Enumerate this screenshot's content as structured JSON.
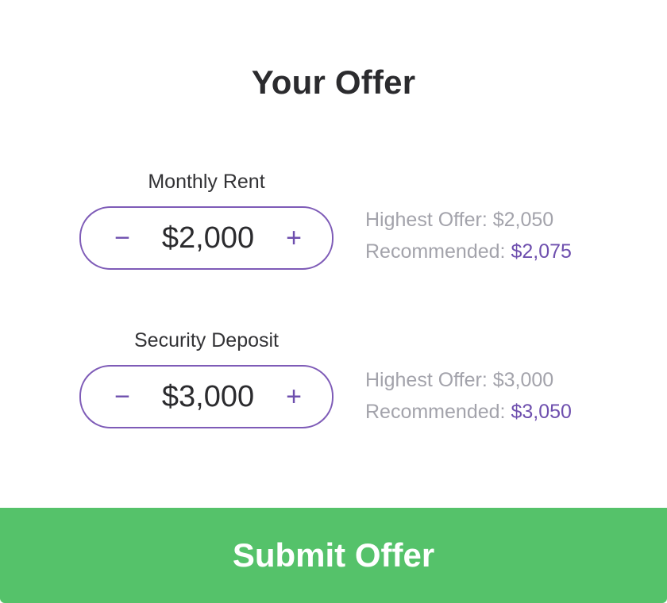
{
  "title": "Your Offer",
  "rent": {
    "label": "Monthly Rent",
    "value": "$2,000",
    "decrement_symbol": "−",
    "increment_symbol": "+",
    "highest_label": "Highest Offer:",
    "highest_value": "$2,050",
    "recommended_label": "Recommended:",
    "recommended_value": "$2,075"
  },
  "deposit": {
    "label": "Security Deposit",
    "value": "$3,000",
    "decrement_symbol": "−",
    "increment_symbol": "+",
    "highest_label": "Highest Offer:",
    "highest_value": "$3,000",
    "recommended_label": "Recommended:",
    "recommended_value": "$3,050"
  },
  "submit_label": "Submit Offer",
  "colors": {
    "accent_purple": "#6e4fae",
    "submit_green": "#55c26a",
    "muted_text": "#a3a3ab"
  }
}
